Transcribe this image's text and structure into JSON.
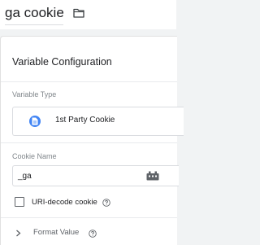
{
  "header": {
    "variable_name": "ga cookie",
    "folder_icon": "folder-icon"
  },
  "panel": {
    "title": "Variable Configuration",
    "variable_type": {
      "label": "Variable Type",
      "value": "1st Party Cookie",
      "icon": "cookie-file-icon",
      "icon_color": "#4285f4"
    },
    "cookie_name": {
      "label": "Cookie Name",
      "value": "_ga",
      "picker_icon": "variable-picker-icon"
    },
    "uri_decode": {
      "label": "URI-decode cookie",
      "checked": false,
      "help_icon": "help-icon"
    },
    "format_value": {
      "label": "Format Value",
      "expand_icon": "chevron-right-icon",
      "help_icon": "help-icon"
    }
  }
}
